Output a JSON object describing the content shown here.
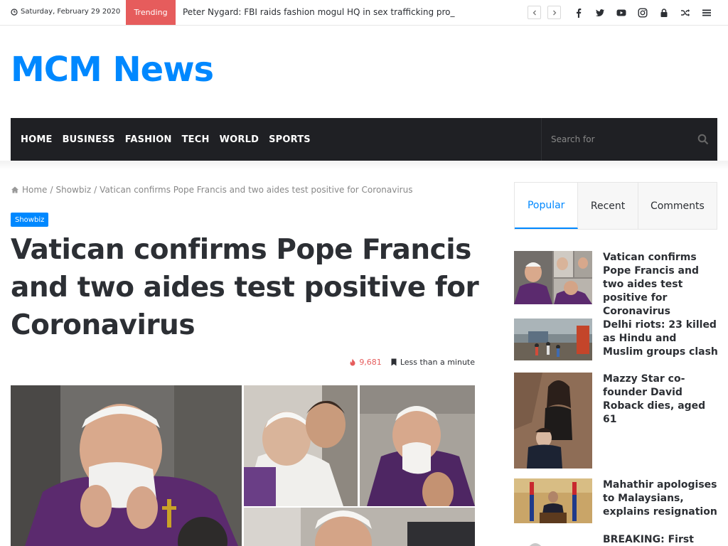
{
  "topbar": {
    "date": "Saturday, February 29 2020",
    "trending_label": "Trending",
    "ticker_text": "Peter Nygard: FBI raids fashion mogul HQ in sex trafficking pro_",
    "icons": [
      "chevron-left-icon",
      "chevron-right-icon",
      "facebook-icon",
      "twitter-icon",
      "youtube-icon",
      "instagram-icon",
      "lock-icon",
      "shuffle-icon",
      "menu-icon"
    ]
  },
  "logo": "MCM News",
  "nav": {
    "items": [
      "HOME",
      "BUSINESS",
      "FASHION",
      "TECH",
      "WORLD",
      "SPORTS"
    ],
    "search_placeholder": "Search for"
  },
  "breadcrumb": {
    "home": "Home",
    "sep": "/",
    "category": "Showbiz",
    "current": "Vatican confirms Pope Francis and two aides test positive for Coronavirus"
  },
  "article": {
    "category_badge": "Showbiz",
    "title": "Vatican confirms Pope Francis and two aides test positive for Coronavirus",
    "views": "9,681",
    "read_time": "Less than a minute"
  },
  "sidebar": {
    "tabs": [
      "Popular",
      "Recent",
      "Comments"
    ],
    "active_tab": "Popular",
    "posts": [
      {
        "title": "Vatican confirms Pope Francis and two aides test positive for Coronavirus"
      },
      {
        "title": "Delhi riots: 23 killed as Hindu and Muslim groups clash"
      },
      {
        "title": "Mazzy Star co-founder David Roback dies, aged 61"
      },
      {
        "title": "Mahathir apologises to Malaysians, explains resignation"
      },
      {
        "title": "BREAKING: First French"
      }
    ]
  },
  "colors": {
    "accent": "#0088ff",
    "trending": "#e65c5c",
    "nav_bg": "#1f2024",
    "text": "#2c2f34"
  }
}
